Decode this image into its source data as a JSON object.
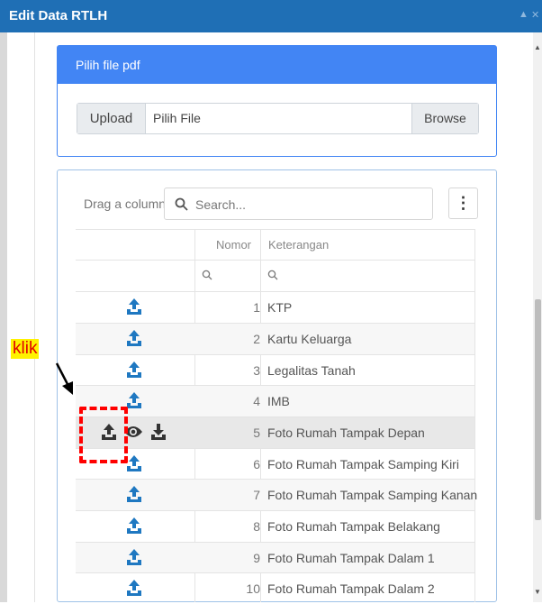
{
  "window": {
    "title": "Edit Data RTLH"
  },
  "upload_card": {
    "header": "Pilih file pdf",
    "upload_label": "Upload",
    "file_placeholder": "Pilih File",
    "browse_label": "Browse"
  },
  "grid": {
    "drag_hint": "Drag a column",
    "search_placeholder": "Search...",
    "menu_glyph": "⋮",
    "col_nomor": "Nomor",
    "col_keterangan": "Keterangan",
    "rows": [
      {
        "nomor": "1",
        "keterangan": "KTP"
      },
      {
        "nomor": "2",
        "keterangan": "Kartu Keluarga"
      },
      {
        "nomor": "3",
        "keterangan": "Legalitas Tanah"
      },
      {
        "nomor": "4",
        "keterangan": "IMB"
      },
      {
        "nomor": "5",
        "keterangan": "Foto Rumah Tampak Depan"
      },
      {
        "nomor": "6",
        "keterangan": "Foto Rumah Tampak Samping Kiri"
      },
      {
        "nomor": "7",
        "keterangan": "Foto Rumah Tampak Samping Kanan"
      },
      {
        "nomor": "8",
        "keterangan": "Foto Rumah Tampak Belakang"
      },
      {
        "nomor": "9",
        "keterangan": "Foto Rumah Tampak Dalam 1"
      },
      {
        "nomor": "10",
        "keterangan": "Foto Rumah Tampak Dalam 2"
      }
    ]
  },
  "annotation": {
    "text": "klik"
  },
  "colors": {
    "accent": "#4285f4",
    "titlebar": "#1f6fb5",
    "upload_icon": "#1f78c1",
    "highlight": "#ff0000"
  }
}
